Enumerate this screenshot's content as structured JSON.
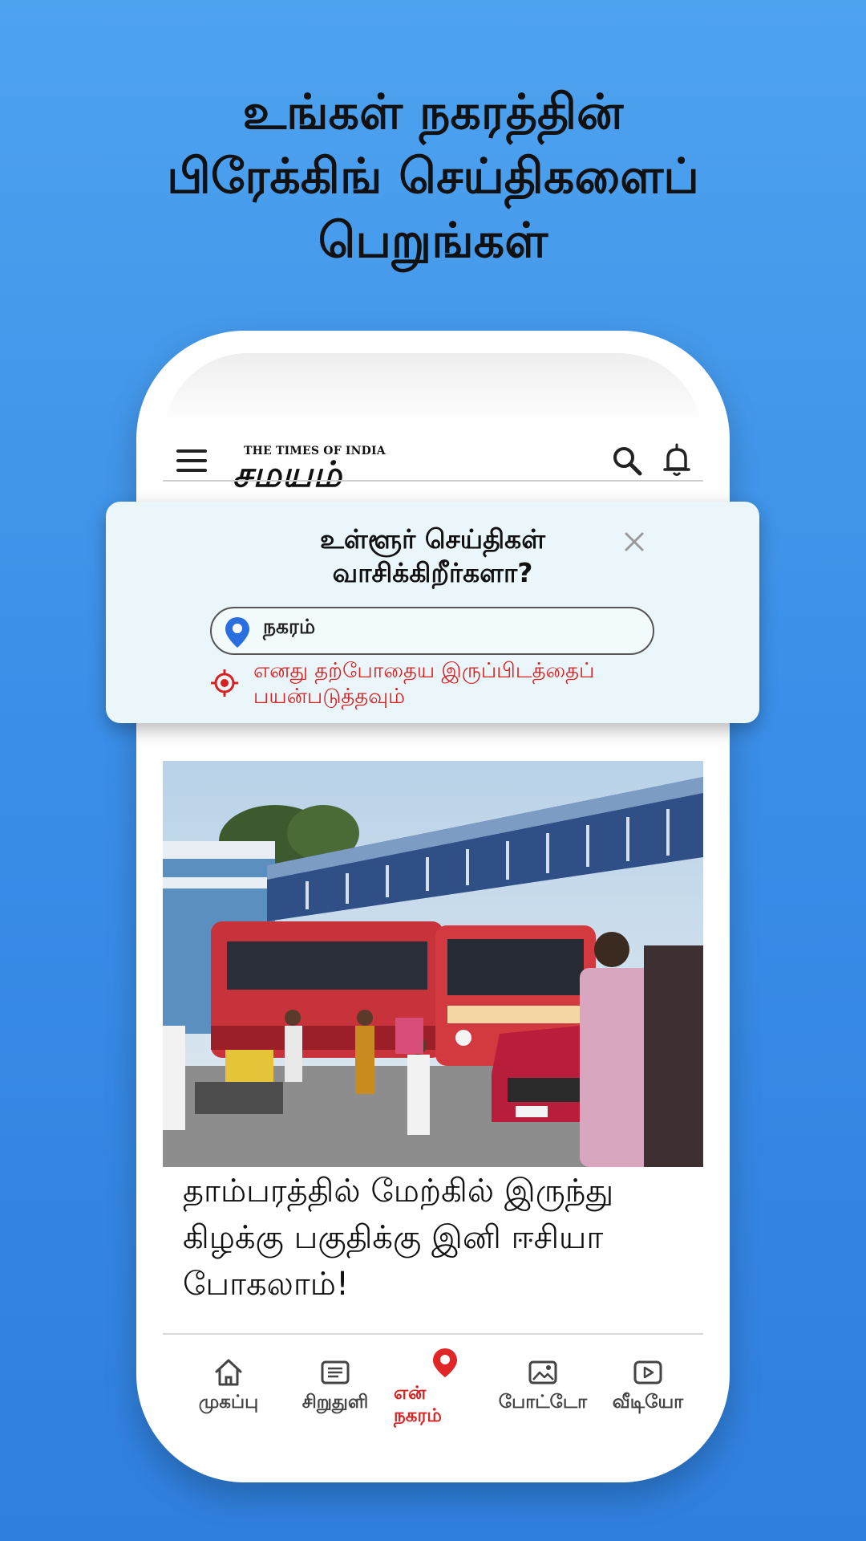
{
  "promo": {
    "headline_line1": "உங்கள் நகரத்தின்",
    "headline_line2": "பிரேக்கிங் செய்திகளைப்",
    "headline_line3": "பெறுங்கள்"
  },
  "app_header": {
    "logo_tagline": "THE TIMES OF INDIA",
    "logo_name": "சமயம்",
    "menu_icon": "menu-icon",
    "search_icon": "search-icon",
    "bell_icon": "bell-icon"
  },
  "popup": {
    "title_line1": "உள்ளூர் செய்திகள்",
    "title_line2": "வாசிக்கிறீர்களா?",
    "city_placeholder": "நகரம்",
    "gps_line1": "எனது தற்போதைய இருப்பிடத்தைப்",
    "gps_line2": "பயன்படுத்தவும்",
    "accent_color": "#d91f1f"
  },
  "article": {
    "title": "தாம்பரத்தில் மேற்கில் இருந்து கிழக்கு பகுதிக்கு இனி ஈசியா போகலாம்!"
  },
  "bottom_nav": {
    "items": [
      {
        "label": "முகப்பு",
        "icon": "home-icon"
      },
      {
        "label": "சிறுதுளி",
        "icon": "news-icon"
      },
      {
        "label_line1": "என்",
        "label_line2": "நகரம்",
        "icon": "location-pin-icon",
        "active": true
      },
      {
        "label": "போட்டோ",
        "icon": "photo-icon"
      },
      {
        "label": "வீடியோ",
        "icon": "video-icon"
      }
    ]
  },
  "colors": {
    "background": "#3b8fe8",
    "active_nav": "#d92323",
    "popup_bg": "#ebf6fb",
    "pin_blue": "#2a6fe0"
  }
}
